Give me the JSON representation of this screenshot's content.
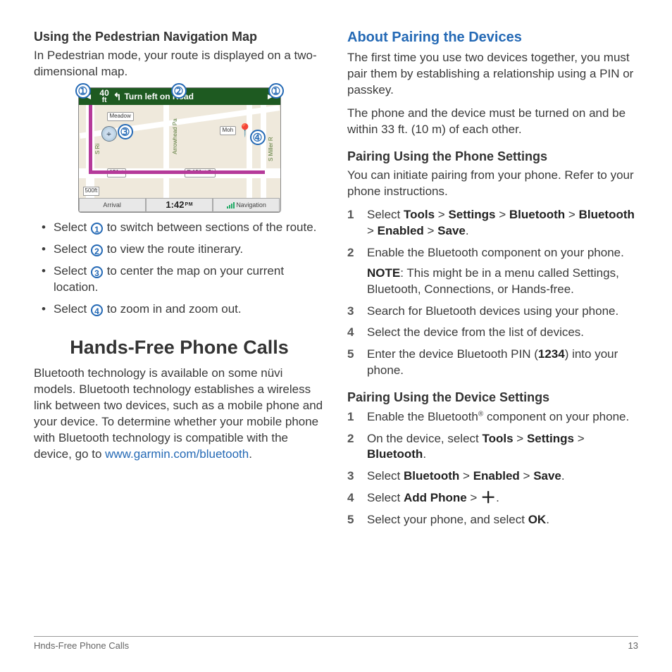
{
  "left": {
    "h3": "Using the Pedestrian Navigation Map",
    "intro": "In Pedestrian mode, your route is displayed on a two-dimensional map.",
    "bullets": [
      {
        "pre": "Select ",
        "num": "1",
        "post": " to switch between sections of the route."
      },
      {
        "pre": "Select ",
        "num": "2",
        "post": " to view the route itinerary."
      },
      {
        "pre": "Select ",
        "num": "3",
        "post": " to center the map on your current location."
      },
      {
        "pre": "Select ",
        "num": "4",
        "post": " to zoom in and zoom out."
      }
    ],
    "h1": "Hands-Free Phone Calls",
    "para_a": "Bluetooth technology is available on some nüvi models. Bluetooth technology establishes a wireless link between two devices, such as a mobile phone and your device. To determine whether your mobile phone with Bluetooth technology is compatible with the device, go to ",
    "link": "www.garmin.com/bluetooth",
    "para_b": "."
  },
  "map": {
    "dist_n": "40",
    "dist_u": "ft",
    "turn_text": "Turn left on Road",
    "left_btn": "Arrival",
    "mid_btn": "1:42",
    "mid_ampm": "P M",
    "right_btn": "Navigation",
    "scale": "500ft",
    "streets": {
      "meadow": "Meadow",
      "mohawk": "Moh",
      "e151": "E 151st St",
      "w151": "151st",
      "arrow": "Arrowhead Pa",
      "riley": "S Ri",
      "miller": "S Miller R"
    }
  },
  "right": {
    "h2": "About Pairing the Devices",
    "p1": "The first time you use two devices together, you must pair them by establishing a relationship using a PIN or passkey.",
    "p2": "The phone and the device must be turned on and be within 33 ft. (10 m) of each other.",
    "h3a": "Pairing Using the Phone Settings",
    "p3": "You can initiate pairing from your phone. Refer to your phone instructions.",
    "ol1": {
      "i1": {
        "a": "Select ",
        "b": "Tools",
        "c": " > ",
        "d": "Settings",
        "e": " > ",
        "f": "Bluetooth",
        "g": " > ",
        "h": "Bluetooth",
        "i": " > ",
        "j": "Enabled",
        "k": " > ",
        "l": "Save",
        "m": "."
      },
      "i2": "Enable the Bluetooth component on your phone.",
      "i2_note_a": "NOTE",
      "i2_note_b": ": This might be in a menu called Settings, Bluetooth, Connections, or Hands-free.",
      "i3": "Search for Bluetooth devices using your phone.",
      "i4": "Select the device from the list of devices.",
      "i5_a": "Enter the device Bluetooth PIN (",
      "i5_b": "1234",
      "i5_c": ") into your phone."
    },
    "h3b": "Pairing Using the Device Settings",
    "ol2": {
      "i1_a": "Enable the Bluetooth",
      "i1_b": " component on your phone.",
      "i2_a": "On the device, select ",
      "i2_b": "Tools",
      "i2_c": " > ",
      "i2_d": "Settings",
      "i2_e": " > ",
      "i2_f": "Bluetooth",
      "i2_g": ".",
      "i3_a": "Select ",
      "i3_b": "Bluetooth",
      "i3_c": " > ",
      "i3_d": "Enabled",
      "i3_e": " > ",
      "i3_f": "Save",
      "i3_g": ".",
      "i4_a": "Select ",
      "i4_b": "Add Phone",
      "i4_c": " > ",
      "i4_d": ".",
      "i5_a": "Select your phone, and select ",
      "i5_b": "OK",
      "i5_c": "."
    }
  },
  "footer": {
    "left": "Hnds-Free Phone Calls",
    "right": "13"
  }
}
